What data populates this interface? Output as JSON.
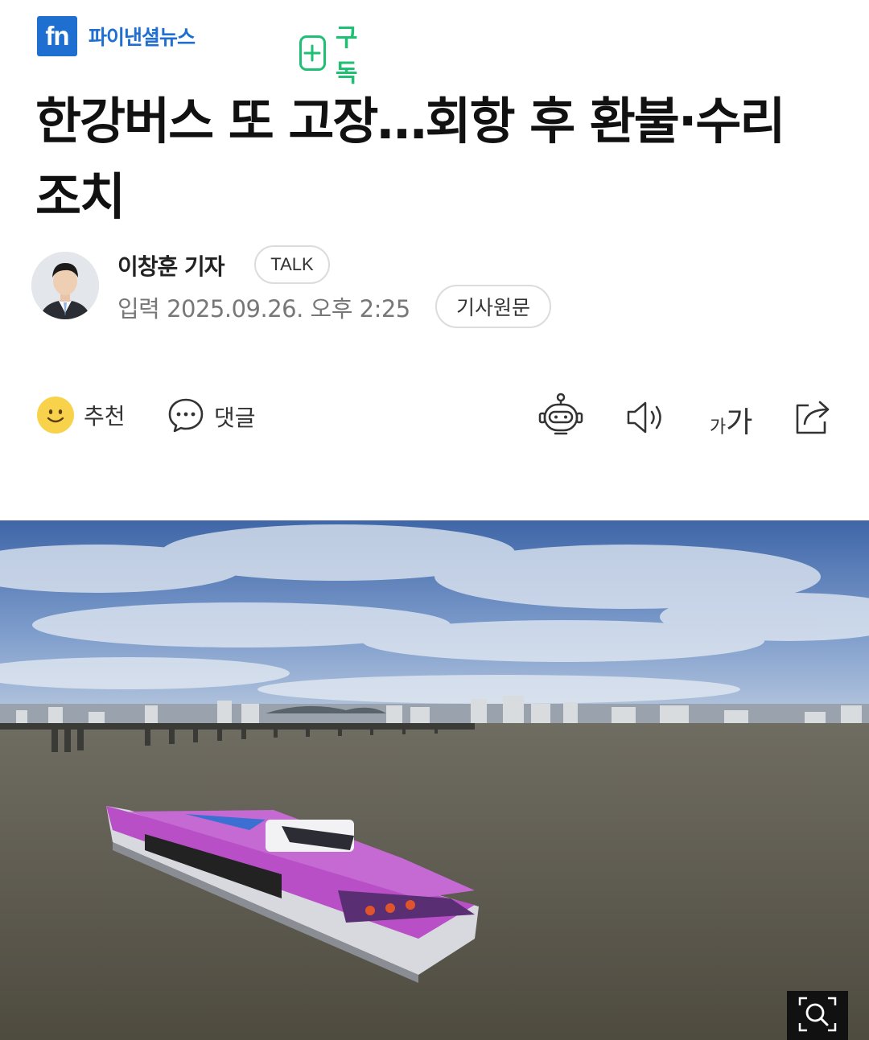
{
  "brand": {
    "logo_text": "fn",
    "name": "파이낸셜뉴스",
    "brand_color": "#1f6fd1"
  },
  "subscribe": {
    "label": "구독",
    "icon": "plus-icon",
    "color": "#1fbf74"
  },
  "article": {
    "title": "한강버스 또 고장…회항 후 환불·수리 조치",
    "reporter": "이창훈 기자",
    "talk_label": "TALK",
    "date": "입력 2025.09.26. 오후 2:25",
    "original_label": "기사원문"
  },
  "toolbar": {
    "recommend_label": "추천",
    "recommend_icon": "smiley-icon",
    "comment_label": "댓글",
    "comment_icon": "speech-bubble-icon",
    "summary_icon": "robot-icon",
    "audio_icon": "speaker-icon",
    "font_size_small": "가",
    "font_size_large": "가",
    "share_icon": "share-icon"
  },
  "photo": {
    "zoom_icon": "zoom-icon"
  }
}
